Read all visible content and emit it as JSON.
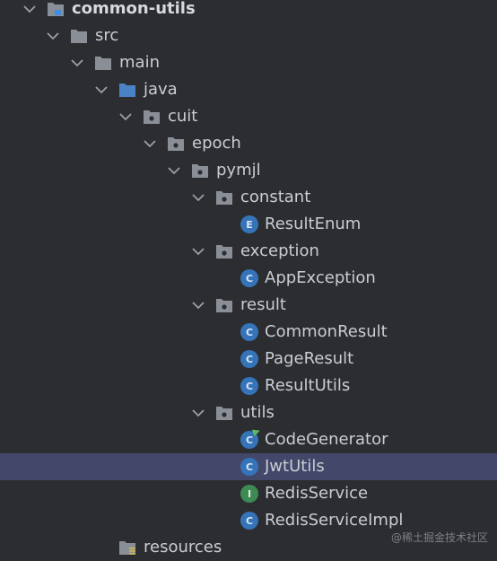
{
  "tree": {
    "root": {
      "label": "common-utils",
      "icon": "module-folder-icon"
    },
    "src": {
      "label": "src",
      "icon": "folder-icon"
    },
    "main": {
      "label": "main",
      "icon": "folder-icon"
    },
    "java": {
      "label": "java",
      "icon": "source-root-folder-icon"
    },
    "cuit": {
      "label": "cuit",
      "icon": "package-icon"
    },
    "epoch": {
      "label": "epoch",
      "icon": "package-icon"
    },
    "pymjl": {
      "label": "pymjl",
      "icon": "package-icon"
    },
    "constant": {
      "label": "constant",
      "icon": "package-icon"
    },
    "resultEnum": {
      "label": "ResultEnum",
      "icon": "enum-icon",
      "glyph": "E"
    },
    "exception": {
      "label": "exception",
      "icon": "package-icon"
    },
    "appException": {
      "label": "AppException",
      "icon": "class-icon",
      "glyph": "C"
    },
    "result": {
      "label": "result",
      "icon": "package-icon"
    },
    "commonResult": {
      "label": "CommonResult",
      "icon": "class-icon",
      "glyph": "C"
    },
    "pageResult": {
      "label": "PageResult",
      "icon": "class-icon",
      "glyph": "C"
    },
    "resultUtils": {
      "label": "ResultUtils",
      "icon": "class-icon",
      "glyph": "C"
    },
    "utils": {
      "label": "utils",
      "icon": "package-icon"
    },
    "codeGenerator": {
      "label": "CodeGenerator",
      "icon": "runnable-class-icon",
      "glyph": "C"
    },
    "jwtUtils": {
      "label": "JwtUtils",
      "icon": "class-icon",
      "glyph": "C",
      "selected": true
    },
    "redisService": {
      "label": "RedisService",
      "icon": "interface-icon",
      "glyph": "I"
    },
    "redisServiceImpl": {
      "label": "RedisServiceImpl",
      "icon": "class-icon",
      "glyph": "C"
    },
    "resources": {
      "label": "resources",
      "icon": "resources-folder-icon"
    }
  },
  "watermark": "@稀土掘金技术社区",
  "colors": {
    "background": "#2b2d30",
    "selection": "#43486a",
    "text": "#c9cdd4",
    "folder": "#8a8e96",
    "source_folder": "#4a82c4",
    "class_icon": "#3574b8",
    "interface_icon": "#3e8a54"
  }
}
